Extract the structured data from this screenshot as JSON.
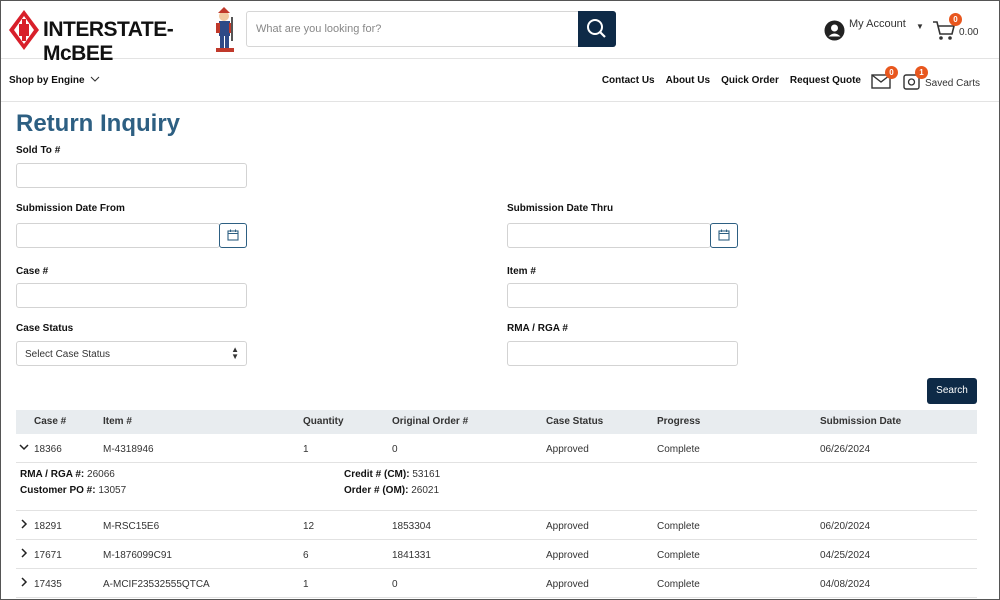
{
  "header": {
    "brand": "INTERSTATE-McBEE",
    "search_placeholder": "What are you looking for?",
    "account_label": "My Account",
    "cart_count": "0",
    "cart_total": "0.00"
  },
  "nav": {
    "shop_by_engine": "Shop by Engine",
    "links": [
      "Contact Us",
      "About Us",
      "Quick Order",
      "Request Quote"
    ],
    "mail_count": "0",
    "saved_carts_count": "1",
    "saved_carts_label": "Saved Carts"
  },
  "page": {
    "title": "Return Inquiry",
    "labels": {
      "sold_to": "Sold To #",
      "date_from": "Submission Date From",
      "date_thru": "Submission Date Thru",
      "case": "Case #",
      "item": "Item #",
      "case_status": "Case Status",
      "rma": "RMA / RGA #"
    },
    "case_status_value": "Select Case Status",
    "search_button": "Search"
  },
  "table": {
    "columns": [
      "Case #",
      "Item #",
      "Quantity",
      "Original Order #",
      "Case Status",
      "Progress",
      "Submission Date"
    ],
    "rows": [
      {
        "case": "18366",
        "item": "M-4318946",
        "qty": "1",
        "order": "0",
        "status": "Approved",
        "progress": "Complete",
        "date": "06/26/2024"
      },
      {
        "case": "18291",
        "item": "M-RSC15E6",
        "qty": "12",
        "order": "1853304",
        "status": "Approved",
        "progress": "Complete",
        "date": "06/20/2024"
      },
      {
        "case": "17671",
        "item": "M-1876099C91",
        "qty": "6",
        "order": "1841331",
        "status": "Approved",
        "progress": "Complete",
        "date": "04/25/2024"
      },
      {
        "case": "17435",
        "item": "A-MCIF23532555QTCA",
        "qty": "1",
        "order": "0",
        "status": "Approved",
        "progress": "Complete",
        "date": "04/08/2024"
      }
    ],
    "detail": {
      "rma_label": "RMA / RGA #:",
      "rma_value": "26066",
      "po_label": "Customer PO #:",
      "po_value": "13057",
      "credit_label": "Credit # (CM):",
      "credit_value": "53161",
      "order_label": "Order # (OM):",
      "order_value": "26021"
    }
  }
}
